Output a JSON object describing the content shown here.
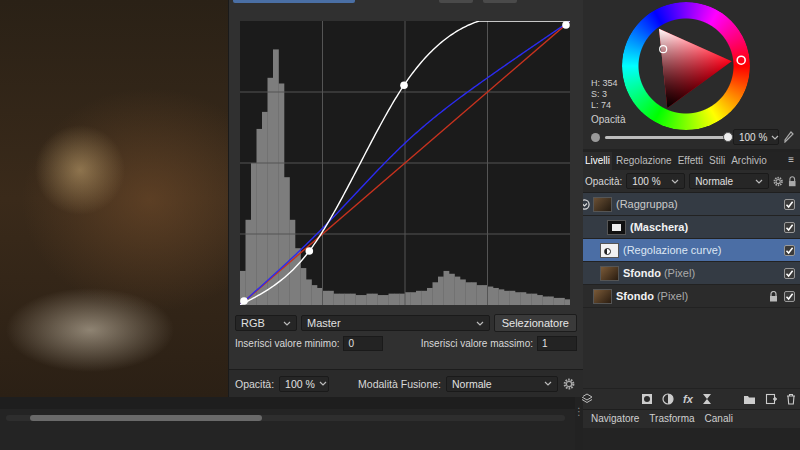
{
  "canvas": {
    "grip": "⋮"
  },
  "curves_dialog": {
    "graph": {
      "series": [
        {
          "color": "#ffffff",
          "handles": true,
          "points": [
            [
              0,
              0
            ],
            [
              0.21,
              0.19
            ],
            [
              0.497,
              0.774
            ],
            [
              1,
              1
            ]
          ]
        },
        {
          "color": "#2b2bf0",
          "handles": false,
          "points": [
            [
              0,
              0
            ],
            [
              0.25,
              0.27
            ],
            [
              0.5,
              0.57
            ],
            [
              0.75,
              0.8
            ],
            [
              1,
              1
            ]
          ]
        },
        {
          "color": "#c8321e",
          "handles": false,
          "points": [
            [
              0,
              0
            ],
            [
              1,
              1
            ]
          ]
        }
      ],
      "histogram": [
        0.12,
        0.3,
        0.5,
        0.62,
        0.68,
        0.8,
        0.9,
        0.78,
        0.45,
        0.3,
        0.2,
        0.13,
        0.09,
        0.07,
        0.06,
        0.05,
        0.05,
        0.04,
        0.04,
        0.04,
        0.04,
        0.035,
        0.035,
        0.04,
        0.04,
        0.035,
        0.035,
        0.04,
        0.04,
        0.04,
        0.045,
        0.045,
        0.05,
        0.05,
        0.06,
        0.08,
        0.1,
        0.12,
        0.11,
        0.1,
        0.09,
        0.08,
        0.08,
        0.07,
        0.07,
        0.065,
        0.06,
        0.055,
        0.05,
        0.05,
        0.045,
        0.045,
        0.04,
        0.04,
        0.035,
        0.03,
        0.03,
        0.025,
        0.025,
        0.02
      ]
    },
    "channel": "RGB",
    "mode": "Master",
    "picker_button": "Selezionatore",
    "min": {
      "label": "Inserisci valore minimo:",
      "value": "0"
    },
    "max": {
      "label": "Inserisci valore massimo:",
      "value": "1"
    },
    "opacity": {
      "label": "Opacità:",
      "value": "100 %"
    },
    "blend": {
      "label": "Modalità Fusione:",
      "value": "Normale"
    }
  },
  "color_panel": {
    "hue": 354,
    "saturation": 0.03,
    "lightness": 0.74,
    "readings": [
      "H: 354",
      "S: 3",
      "L: 74"
    ],
    "opacity_label": "Opacità",
    "opacity_level": 1,
    "opacity_value": "100 %"
  },
  "layers_panel": {
    "tabs": [
      {
        "label": "Livelli",
        "selected": true
      },
      {
        "label": "Regolazione",
        "selected": false
      },
      {
        "label": "Effetti",
        "selected": false
      },
      {
        "label": "Stili",
        "selected": false
      },
      {
        "label": "Archivio",
        "selected": false
      }
    ],
    "menu": "≡",
    "opacity_label": "Opacità:",
    "opacity_value": "100 %",
    "blend": "Normale",
    "layers": [
      {
        "name": "(Raggruppa)",
        "suffix": "",
        "bold": false,
        "kind": "group",
        "depth": 0,
        "selected": false,
        "grouped": true,
        "visible": true,
        "locked": false,
        "expanded": true
      },
      {
        "name": "(Maschera)",
        "suffix": "",
        "bold": true,
        "kind": "mask",
        "depth": 2,
        "selected": false,
        "grouped": true,
        "visible": true,
        "locked": false
      },
      {
        "name": "(Regolazione curve)",
        "suffix": "",
        "bold": false,
        "kind": "adjustment",
        "depth": 1,
        "selected": true,
        "grouped": true,
        "visible": true,
        "locked": false
      },
      {
        "name": "Sfondo",
        "suffix": "(Pixel)",
        "bold": true,
        "kind": "pixel",
        "depth": 1,
        "selected": false,
        "grouped": true,
        "visible": true,
        "locked": false
      },
      {
        "name": "Sfondo",
        "suffix": "(Pixel)",
        "bold": true,
        "kind": "pixel",
        "depth": 0,
        "selected": false,
        "grouped": false,
        "visible": true,
        "locked": true
      }
    ],
    "toolbar": {
      "fx": "fx"
    },
    "bottom_tabs": [
      {
        "label": "Navigatore",
        "selected": false
      },
      {
        "label": "Trasforma",
        "selected": false
      },
      {
        "label": "Canali",
        "selected": false
      }
    ]
  }
}
